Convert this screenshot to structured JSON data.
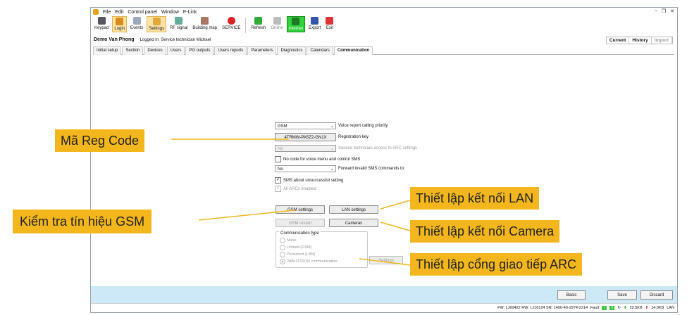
{
  "menu": {
    "items": [
      "File",
      "Edit",
      "Control panel",
      "Window",
      "F-Link"
    ]
  },
  "toolbar": {
    "buttons": [
      "Keypad",
      "Login",
      "Events",
      "Settings",
      "RF signal",
      "Building map",
      "SERVICE",
      "Refresh",
      "Online",
      "Internet",
      "Export",
      "Exit"
    ]
  },
  "header": {
    "site": "Demo Van Phong",
    "logged_in": "Logged in: Service technician Michael"
  },
  "view_tabs": [
    "Current",
    "History",
    "Import"
  ],
  "tabs": [
    "Initial setup",
    "Section",
    "Devices",
    "Users",
    "PG outputs",
    "Users reports",
    "Parameters",
    "Diagnostics",
    "Calendars",
    "Communication"
  ],
  "form": {
    "voice_priority_value": "GSM",
    "voice_priority_label": "Voice report calling priority",
    "registration_key_value": "4TRMW-PA5Z2-GN1X",
    "registration_key_label": "Registration key",
    "tech_access_value": "No",
    "tech_access_label": "Service technician access to ARC settings",
    "no_code_label": "No code for voice menu and control SMS",
    "forward_sms_value": "No",
    "forward_sms_label": "Forward invalid SMS commands to:",
    "sms_unsuccessful_label": "SMS about unsuccessful setting",
    "all_arcs_label": "All ARCs enabled",
    "gsm_settings": "GSM settings",
    "lan_settings": "LAN settings",
    "gsm_restart": "GSM restart",
    "cameras": "Cameras",
    "comm_type_title": "Communication type",
    "comm_options": [
      "None",
      "Limited (GSM)",
      "Persistent (LAN)",
      "JABLOTRON communication"
    ],
    "settings": "Settings"
  },
  "bottom": {
    "basic": "Basic",
    "save": "Save",
    "discard": "Discard"
  },
  "statusbar": {
    "fw": "FW: LJ60422 HW: LJ16124 SN: 1400-40-2974-2214",
    "fault": "Fault",
    "led1": "1",
    "led2": "2",
    "download": "22.5KB",
    "upload": "14.0KB",
    "conn": "LAN"
  },
  "callouts": {
    "reg_code": "Mã Reg Code",
    "gsm_signal": "Kiểm tra tín hiệu GSM",
    "lan": "Thiết lập kết nối LAN",
    "camera": "Thiết lập kết nối Camera",
    "arc": "Thiết lập cổng giao tiếp ARC"
  },
  "colors": {
    "callout": "#f3b71d",
    "bottom_bar": "#cde9f8",
    "internet": "#31d13b"
  }
}
